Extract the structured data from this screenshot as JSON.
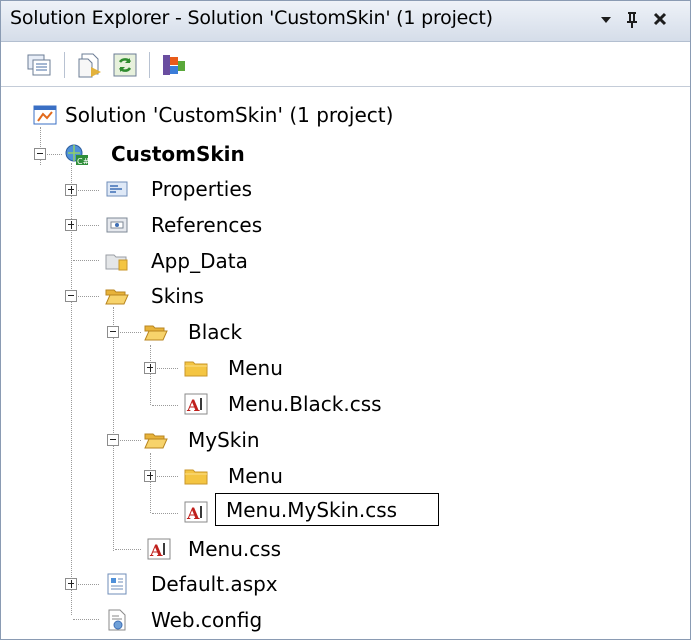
{
  "window": {
    "title": "Solution Explorer - Solution 'CustomSkin' (1 project)",
    "dropdown_glyph": "▾",
    "pin_glyph": "ᵖ",
    "close_glyph": "✕"
  },
  "toolbar": {
    "buttons": [
      "properties-icon",
      "show-all-files-icon",
      "refresh-icon",
      "class-diagram-icon"
    ]
  },
  "tree": {
    "solution": "Solution 'CustomSkin' (1 project)",
    "project": "CustomSkin",
    "properties": "Properties",
    "references": "References",
    "app_data": "App_Data",
    "skins": "Skins",
    "black": "Black",
    "black_menu": "Menu",
    "black_css": "Menu.Black.css",
    "myskin": "MySkin",
    "myskin_menu": "Menu",
    "myskin_css": "Menu.MySkin.css",
    "menu_css": "Menu.css",
    "default_aspx": "Default.aspx",
    "web_config": "Web.config"
  },
  "colors": {
    "title_gradient_top": "#eef2f8",
    "title_gradient_bottom": "#d5dde9",
    "border": "#8a9bb3",
    "folder": "#f4c542"
  }
}
